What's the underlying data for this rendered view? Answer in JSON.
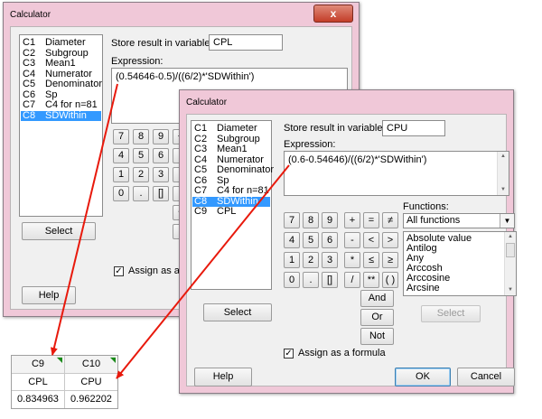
{
  "back_window": {
    "title": "Calculator",
    "title_extra": "                         ",
    "close_label": "x",
    "columns": [
      {
        "code": "C1",
        "name": "Diameter"
      },
      {
        "code": "C2",
        "name": "Subgroup"
      },
      {
        "code": "C3",
        "name": "Mean1"
      },
      {
        "code": "C4",
        "name": "Numerator"
      },
      {
        "code": "C5",
        "name": "Denominator"
      },
      {
        "code": "C6",
        "name": "Sp"
      },
      {
        "code": "C7",
        "name": "C4 for n=81"
      },
      {
        "code": "C8",
        "name": "SDWithin"
      }
    ],
    "store_label": "Store result in variable:",
    "store_value": "CPL",
    "expression_label": "Expression:",
    "expression": "(0.54646-0.5)/((6/2)*'SDWithin')",
    "keypad": [
      "7",
      "8",
      "9",
      "+",
      "4",
      "5",
      "6",
      "-",
      "1",
      "2",
      "3",
      "*",
      "0",
      ".",
      "[]",
      "/",
      "^",
      "("
    ],
    "select_label": "Select",
    "assign_label": "Assign as a formula",
    "help_label": "Help"
  },
  "front_window": {
    "title": "Calculator",
    "columns": [
      {
        "code": "C1",
        "name": "Diameter"
      },
      {
        "code": "C2",
        "name": "Subgroup"
      },
      {
        "code": "C3",
        "name": "Mean1"
      },
      {
        "code": "C4",
        "name": "Numerator"
      },
      {
        "code": "C5",
        "name": "Denominator"
      },
      {
        "code": "C6",
        "name": "Sp"
      },
      {
        "code": "C7",
        "name": "C4 for n=81"
      },
      {
        "code": "C8",
        "name": "SDWithin"
      },
      {
        "code": "C9",
        "name": "CPL"
      }
    ],
    "store_label": "Store result in variable:",
    "store_value": "CPU",
    "expression_label": "Expression:",
    "expression": "(0.6-0.54646)/((6/2)*'SDWithin')",
    "keypad": {
      "digits": [
        "7",
        "8",
        "9",
        "4",
        "5",
        "6",
        "1",
        "2",
        "3",
        "0",
        ".",
        "[]"
      ],
      "ops": [
        "+",
        "=",
        "≠",
        "-",
        "<",
        ">",
        "*",
        "≤",
        "≥",
        "/",
        "**",
        "( )"
      ],
      "logic": [
        "And",
        "Or",
        "Not"
      ]
    },
    "functions_label": "Functions:",
    "functions_selected": "All functions",
    "functions_list": [
      "Absolute value",
      "Antilog",
      "Any",
      "Arccosh",
      "Arccosine",
      "Arcsine"
    ],
    "select_label": "Select",
    "functions_select_label": "Select",
    "assign_label": "Assign as a formula",
    "help_label": "Help",
    "ok_label": "OK",
    "cancel_label": "Cancel"
  },
  "worksheet": {
    "columns": [
      {
        "header": "C9",
        "name": "CPL",
        "value": "0.834963"
      },
      {
        "header": "C10",
        "name": "CPU",
        "value": "0.962202"
      }
    ]
  },
  "colors": {
    "window_frame": "#f0c8d8",
    "selection": "#3399ff",
    "arrow": "#e8190c",
    "close_button": "#c9432e"
  }
}
